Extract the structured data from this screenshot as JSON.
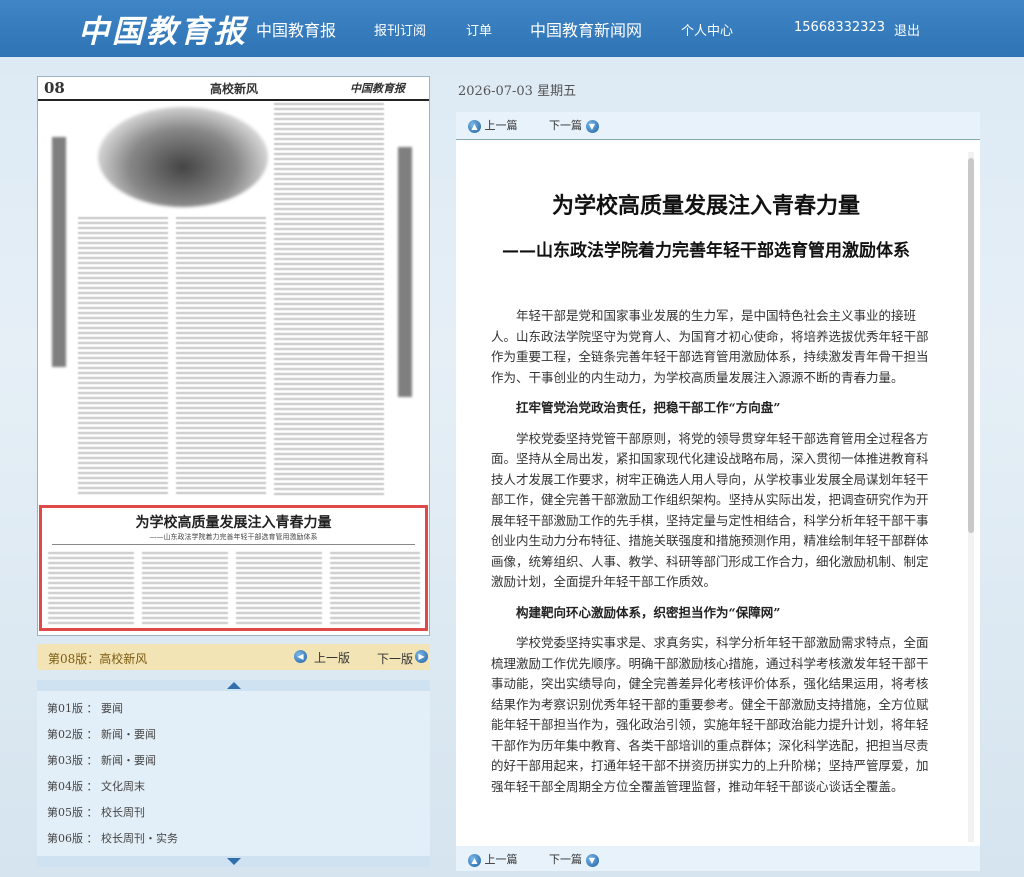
{
  "header": {
    "logo_text": "中国教育报",
    "nav": [
      "中国教育报",
      "报刊订阅",
      "订单",
      "中国教育新闻网",
      "个人中心",
      "15668332323",
      "退出"
    ]
  },
  "paper": {
    "page_no": "08",
    "section": "高校新风",
    "brand": "中国教育报",
    "highlight_title": "为学校高质量发展注入青春力量",
    "highlight_sub": "——山东政法学院着力完善年轻干部选育管用激励体系"
  },
  "pagebar": {
    "current": "第08版：高校新风",
    "prev": "上一版",
    "next": "下一版"
  },
  "page_list": [
    "第01版 ： 要闻",
    "第02版 ： 新闻・要闻",
    "第03版 ： 新闻・要闻",
    "第04版 ： 文化周末",
    "第05版 ： 校长周刊",
    "第06版 ： 校长周刊・实务"
  ],
  "article": {
    "date": "2026-07-03 星期五",
    "prev": "上一篇",
    "next": "下一篇",
    "title": "为学校高质量发展注入青春力量",
    "subtitle": "——山东政法学院着力完善年轻干部选育管用激励体系",
    "paragraphs": [
      {
        "type": "p",
        "text": "年轻干部是党和国家事业发展的生力军，是中国特色社会主义事业的接班人。山东政法学院坚守为党育人、为国育才初心使命，将培养选拔优秀年轻干部作为重要工程，全链条完善年轻干部选育管用激励体系，持续激发青年骨干担当作为、干事创业的内生动力，为学校高质量发展注入源源不断的青春力量。"
      },
      {
        "type": "h",
        "text": "扛牢管党治党政治责任，把稳干部工作“方向盘”"
      },
      {
        "type": "p",
        "text": "学校党委坚持党管干部原则，将党的领导贯穿年轻干部选育管用全过程各方面。坚持从全局出发，紧扣国家现代化建设战略布局，深入贯彻一体推进教育科技人才发展工作要求，树牢正确选人用人导向，从学校事业发展全局谋划年轻干部工作，健全完善干部激励工作组织架构。坚持从实际出发，把调查研究作为开展年轻干部激励工作的先手棋，坚持定量与定性相结合，科学分析年轻干部干事创业内生动力分布特征、措施关联强度和措施预测作用，精准绘制年轻干部群体画像，统筹组织、人事、教学、科研等部门形成工作合力，细化激励机制、制定激励计划，全面提升年轻干部工作质效。"
      },
      {
        "type": "h",
        "text": "构建靶向环心激励体系，织密担当作为“保障网”"
      },
      {
        "type": "p",
        "text": "学校党委坚持实事求是、求真务实，科学分析年轻干部激励需求特点，全面梳理激励工作优先顺序。明确干部激励核心措施，通过科学考核激发年轻干部干事动能，突出实绩导向，健全完善差异化考核评价体系，强化结果运用，将考核结果作为考察识别优秀年轻干部的重要参考。健全干部激励支持措施，全方位赋能年轻干部担当作为，强化政治引领，实施年轻干部政治能力提升计划，将年轻干部作为历年集中教育、各类干部培训的重点群体；深化科学选配，把担当尽责的好干部用起来，打通年轻干部不拼资历拼实力的上升阶梯；坚持严管厚爱，加强年轻干部全周期全方位全覆盖管理监督，推动年轻干部谈心谈话全覆盖。"
      }
    ]
  }
}
